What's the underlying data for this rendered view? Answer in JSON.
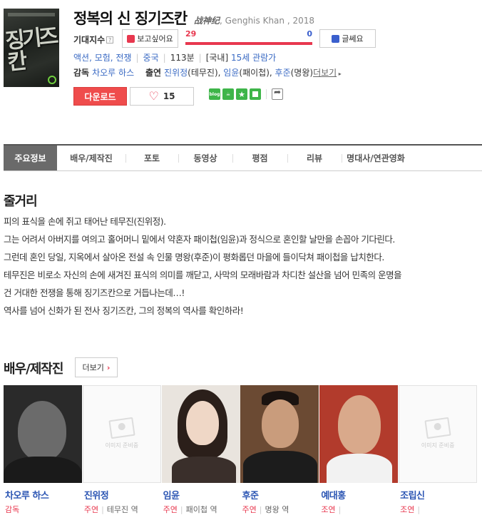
{
  "movie": {
    "title": "정복의 신 징기즈칸",
    "original_title": "战神纪",
    "subtitle_rest": ", Genghis Khan , 2018",
    "poster_text": "징기즈칸"
  },
  "expect": {
    "label": "기대지수",
    "help": "?",
    "want_label": "보고싶어요",
    "want_count": "29",
    "meh_count": "0",
    "want_ratio": 1.0,
    "meh_label": "글쎄요"
  },
  "info": {
    "genres": "액션, 모험, 전쟁",
    "country": "중국",
    "runtime": "113분",
    "rating_prefix": "[국내]",
    "rating": "15세 관람가"
  },
  "credits": {
    "director_label": "감독",
    "director": "차오루 하스",
    "cast_label": "출연",
    "cast": [
      {
        "name": "진위정",
        "role": "(테무진),"
      },
      {
        "name": "임윤",
        "role": "(패이첩),"
      },
      {
        "name": "후준",
        "role": "(명왕)"
      }
    ],
    "more": "더보기"
  },
  "actions": {
    "download": "다운로드",
    "like_count": "15",
    "blog": "blog"
  },
  "tabs": [
    "주요정보",
    "배우/제작진",
    "포토",
    "동영상",
    "평점",
    "리뷰",
    "명대사/연관영화"
  ],
  "synopsis": {
    "title": "줄거리",
    "lines": [
      "피의 표식을 손에 쥐고 태어난 테무진(진위정).",
      "  그는 어려서 아버지를 여의고 홀어머니 밑에서 약혼자 패이첩(임윤)과 정식으로 혼인할 날만을 손꼽아 기다린다.",
      "  그런데 혼인 당일, 지옥에서 살아온 전설 속 인물 명왕(후준)이 평화롭던 마을에 들이닥쳐 패이첩을 납치한다.",
      "  테무진은 비로소 자신의 손에 새겨진 표식의 의미를 깨닫고, 사막의 모래바람과 차디찬 설산을 넘어 민족의 운명을",
      "건 거대한 전쟁을 통해 징기즈칸으로 거듭나는데…!",
      "  역사를 넘어 신화가 된 전사 징기즈칸, 그의 정복의 역사를 확인하라!"
    ]
  },
  "cast_section": {
    "title": "배우/제작진",
    "more": "더보기",
    "placeholder_text": "이미지 준비중",
    "people": [
      {
        "name": "차오루 하스",
        "role": "감독",
        "character": ""
      },
      {
        "name": "진위정",
        "role": "주연",
        "character": "테무진 역"
      },
      {
        "name": "임윤",
        "role": "주연",
        "character": "패이첩 역"
      },
      {
        "name": "후준",
        "role": "주연",
        "character": "명왕 역"
      },
      {
        "name": "예대홍",
        "role": "조연",
        "character": ""
      },
      {
        "name": "조립신",
        "role": "조연",
        "character": ""
      }
    ]
  }
}
